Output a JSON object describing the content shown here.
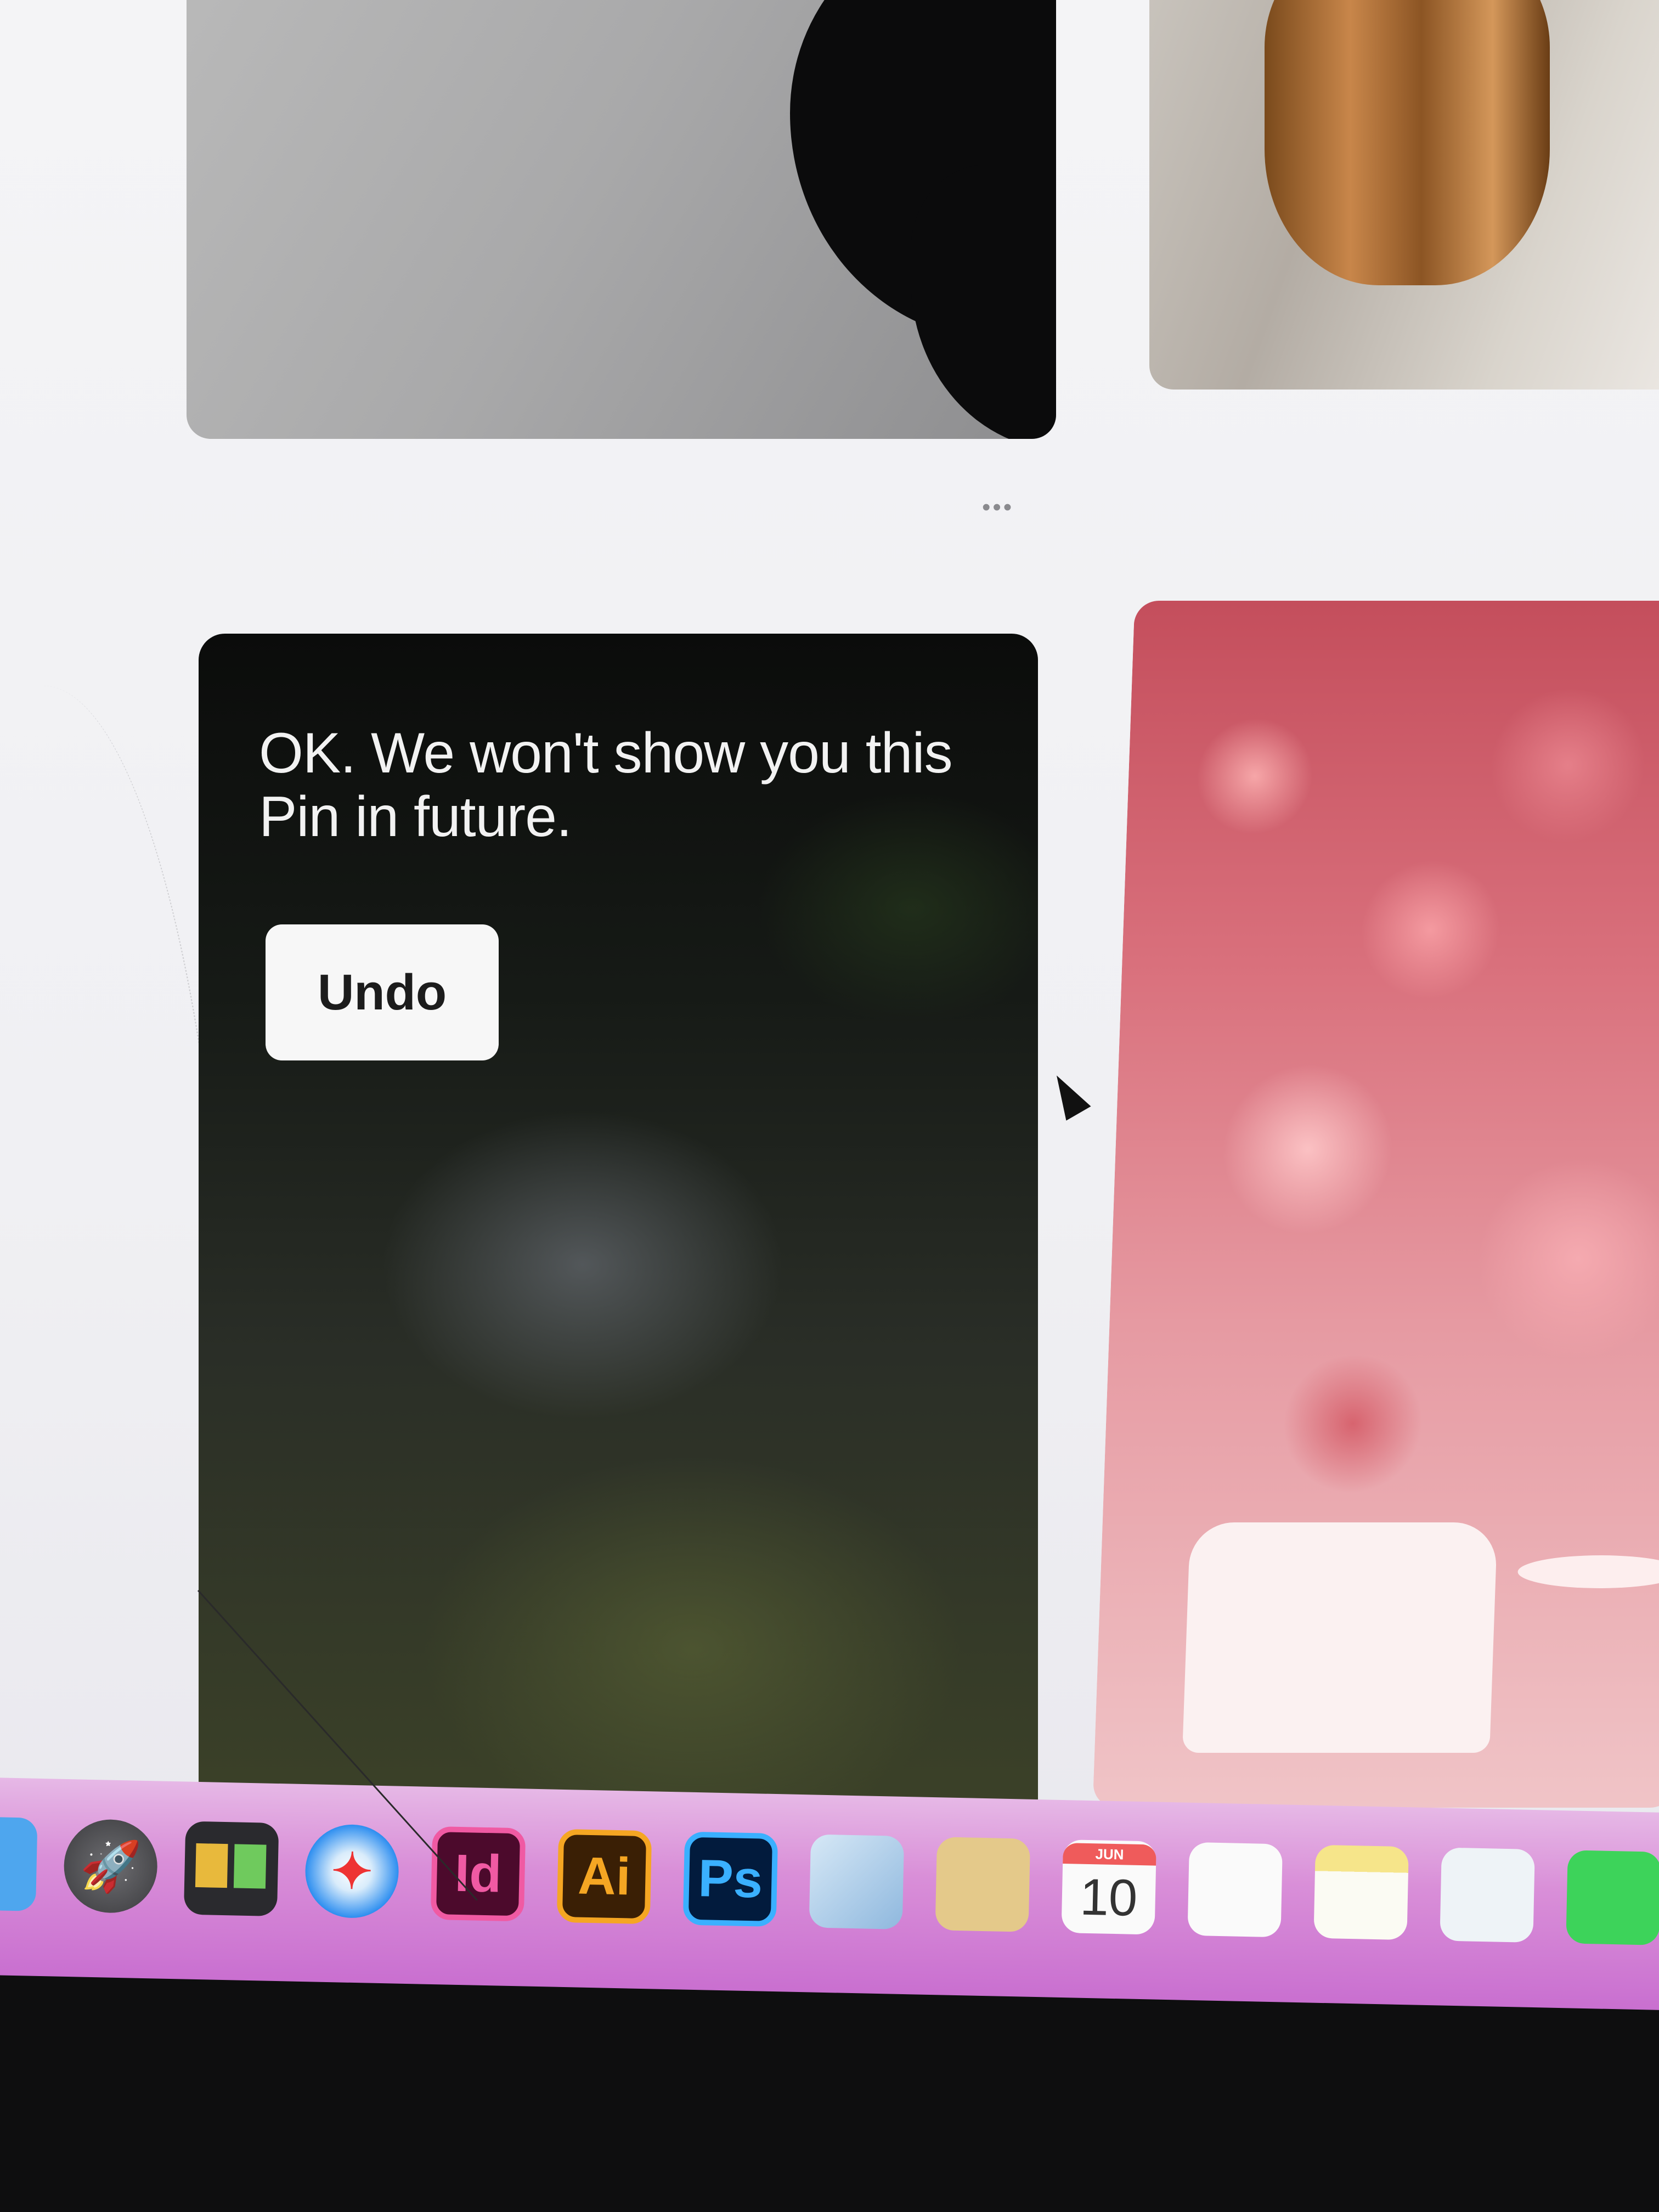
{
  "feed": {
    "more_label": "•••",
    "hidden_pin": {
      "message": "OK. We won't show you this Pin in future.",
      "undo_label": "Undo"
    }
  },
  "dock": {
    "items": [
      {
        "name": "finder",
        "label": ""
      },
      {
        "name": "launchpad",
        "label": "🚀"
      },
      {
        "name": "mission-control",
        "label": ""
      },
      {
        "name": "safari",
        "label": "✦"
      },
      {
        "name": "indesign",
        "label": "Id"
      },
      {
        "name": "illustrator",
        "label": "Ai"
      },
      {
        "name": "photoshop",
        "label": "Ps"
      },
      {
        "name": "preview",
        "label": ""
      },
      {
        "name": "folder",
        "label": ""
      },
      {
        "name": "calendar",
        "month": "JUN",
        "day": "10"
      },
      {
        "name": "reminders",
        "label": ""
      },
      {
        "name": "notes",
        "label": ""
      },
      {
        "name": "preferences",
        "label": ""
      },
      {
        "name": "messages",
        "label": ""
      }
    ]
  },
  "colors": {
    "dock_background": "#d98fd8",
    "undo_button_bg": "#f7f7f7",
    "message_text": "#f2f2f2"
  }
}
